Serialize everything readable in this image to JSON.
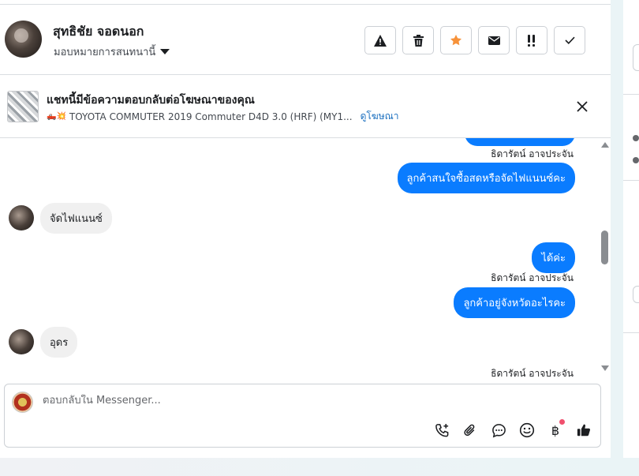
{
  "header": {
    "contact_name": "สุทธิชัย จอดนอก",
    "assign_label": "มอบหมายการสนทนานี้",
    "toolbar": [
      {
        "name": "report-spam-button",
        "icon": "warning-icon"
      },
      {
        "name": "delete-button",
        "icon": "trash-icon"
      },
      {
        "name": "star-button",
        "icon": "star-icon"
      },
      {
        "name": "mark-unread-button",
        "icon": "envelope-icon"
      },
      {
        "name": "follow-up-button",
        "icon": "exclamation-icon"
      },
      {
        "name": "mark-done-button",
        "icon": "check-icon"
      }
    ]
  },
  "ad_banner": {
    "title": "แชทนี้มีข้อความตอบกลับต่อโฆษณาของคุณ",
    "emoji": "🛻💥",
    "ad_text": "TOYOTA COMMUTER 2019 Commuter D4D 3.0 (HRF) (MY1...",
    "link": "ดูโฆษณา"
  },
  "messages": [
    {
      "type": "sender",
      "text": "ธิดารัตน์ อาจประจัน"
    },
    {
      "type": "out",
      "text": "ลูกค้าสนใจซื้อสดหรือจัดไฟแนนซ์คะ"
    },
    {
      "type": "in",
      "text": "จัดไฟแนนซ์"
    },
    {
      "type": "out",
      "text": "ได้ค่ะ"
    },
    {
      "type": "sender",
      "text": "ธิดารัตน์ อาจประจัน"
    },
    {
      "type": "out",
      "text": "ลูกค้าอยู่จังหวัดอะไรคะ"
    },
    {
      "type": "in",
      "text": "อุดร"
    },
    {
      "type": "sender",
      "text": "ธิดารัตน์ อาจประจัน"
    }
  ],
  "composer": {
    "placeholder": "ตอบกลับใน Messenger...",
    "icons": [
      "call-add-icon",
      "attachment-icon",
      "saved-reply-icon",
      "emoji-icon",
      "payment-baht-icon",
      "like-icon"
    ],
    "currency_symbol": "฿"
  },
  "colors": {
    "accent": "#0a7cff",
    "star": "#f7923a",
    "link": "#1a6fbf"
  }
}
